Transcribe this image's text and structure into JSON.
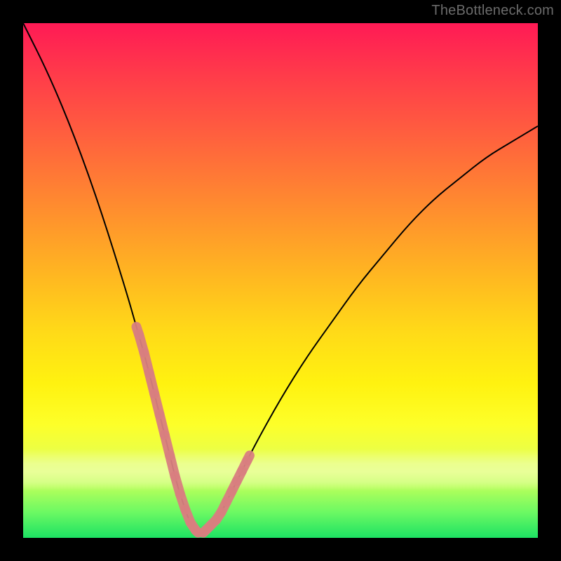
{
  "watermark": {
    "text": "TheBottleneck.com"
  },
  "colors": {
    "background": "#000000",
    "curve": "#000000",
    "marker": "#d97f80",
    "gradient_top": "#ff1a55",
    "gradient_bottom": "#1de263"
  },
  "chart_data": {
    "type": "line",
    "title": "",
    "xlabel": "",
    "ylabel": "",
    "xlim": [
      0,
      100
    ],
    "ylim": [
      0,
      100
    ],
    "grid": false,
    "legend": false,
    "series": [
      {
        "name": "bottleneck-curve",
        "x": [
          0,
          5,
          10,
          15,
          20,
          22,
          24,
          26,
          28,
          30,
          31,
          32,
          33,
          34,
          35,
          36,
          38,
          40,
          42,
          45,
          50,
          55,
          60,
          65,
          70,
          75,
          80,
          85,
          90,
          95,
          100
        ],
        "values": [
          100,
          90,
          78,
          64,
          48,
          41,
          34,
          26,
          18,
          10,
          7,
          4,
          2,
          1,
          1,
          2,
          4,
          8,
          12,
          18,
          27,
          35,
          42,
          49,
          55,
          61,
          66,
          70,
          74,
          77,
          80
        ],
        "_note": "values are bottleneck percentage; minimum ≈0 at x≈34, left arm rises to 100 at x=0, right arm rises to ≈80 at x=100"
      },
      {
        "name": "pink-markers-left",
        "x": [
          22,
          23,
          24,
          25,
          26,
          27,
          28,
          29,
          30,
          31,
          32,
          33,
          34
        ],
        "values": [
          41,
          38,
          34,
          30,
          26,
          22,
          18,
          14,
          10,
          7,
          4,
          2,
          1
        ]
      },
      {
        "name": "pink-markers-right",
        "x": [
          35,
          36,
          37,
          38,
          39,
          40,
          41,
          42,
          43,
          44
        ],
        "values": [
          1,
          2,
          3,
          4,
          6,
          8,
          10,
          12,
          14,
          16
        ]
      }
    ],
    "annotations": [
      {
        "text": "TheBottleneck.com",
        "position": "top-right"
      }
    ],
    "highlight_band_y": [
      8,
      18
    ]
  }
}
